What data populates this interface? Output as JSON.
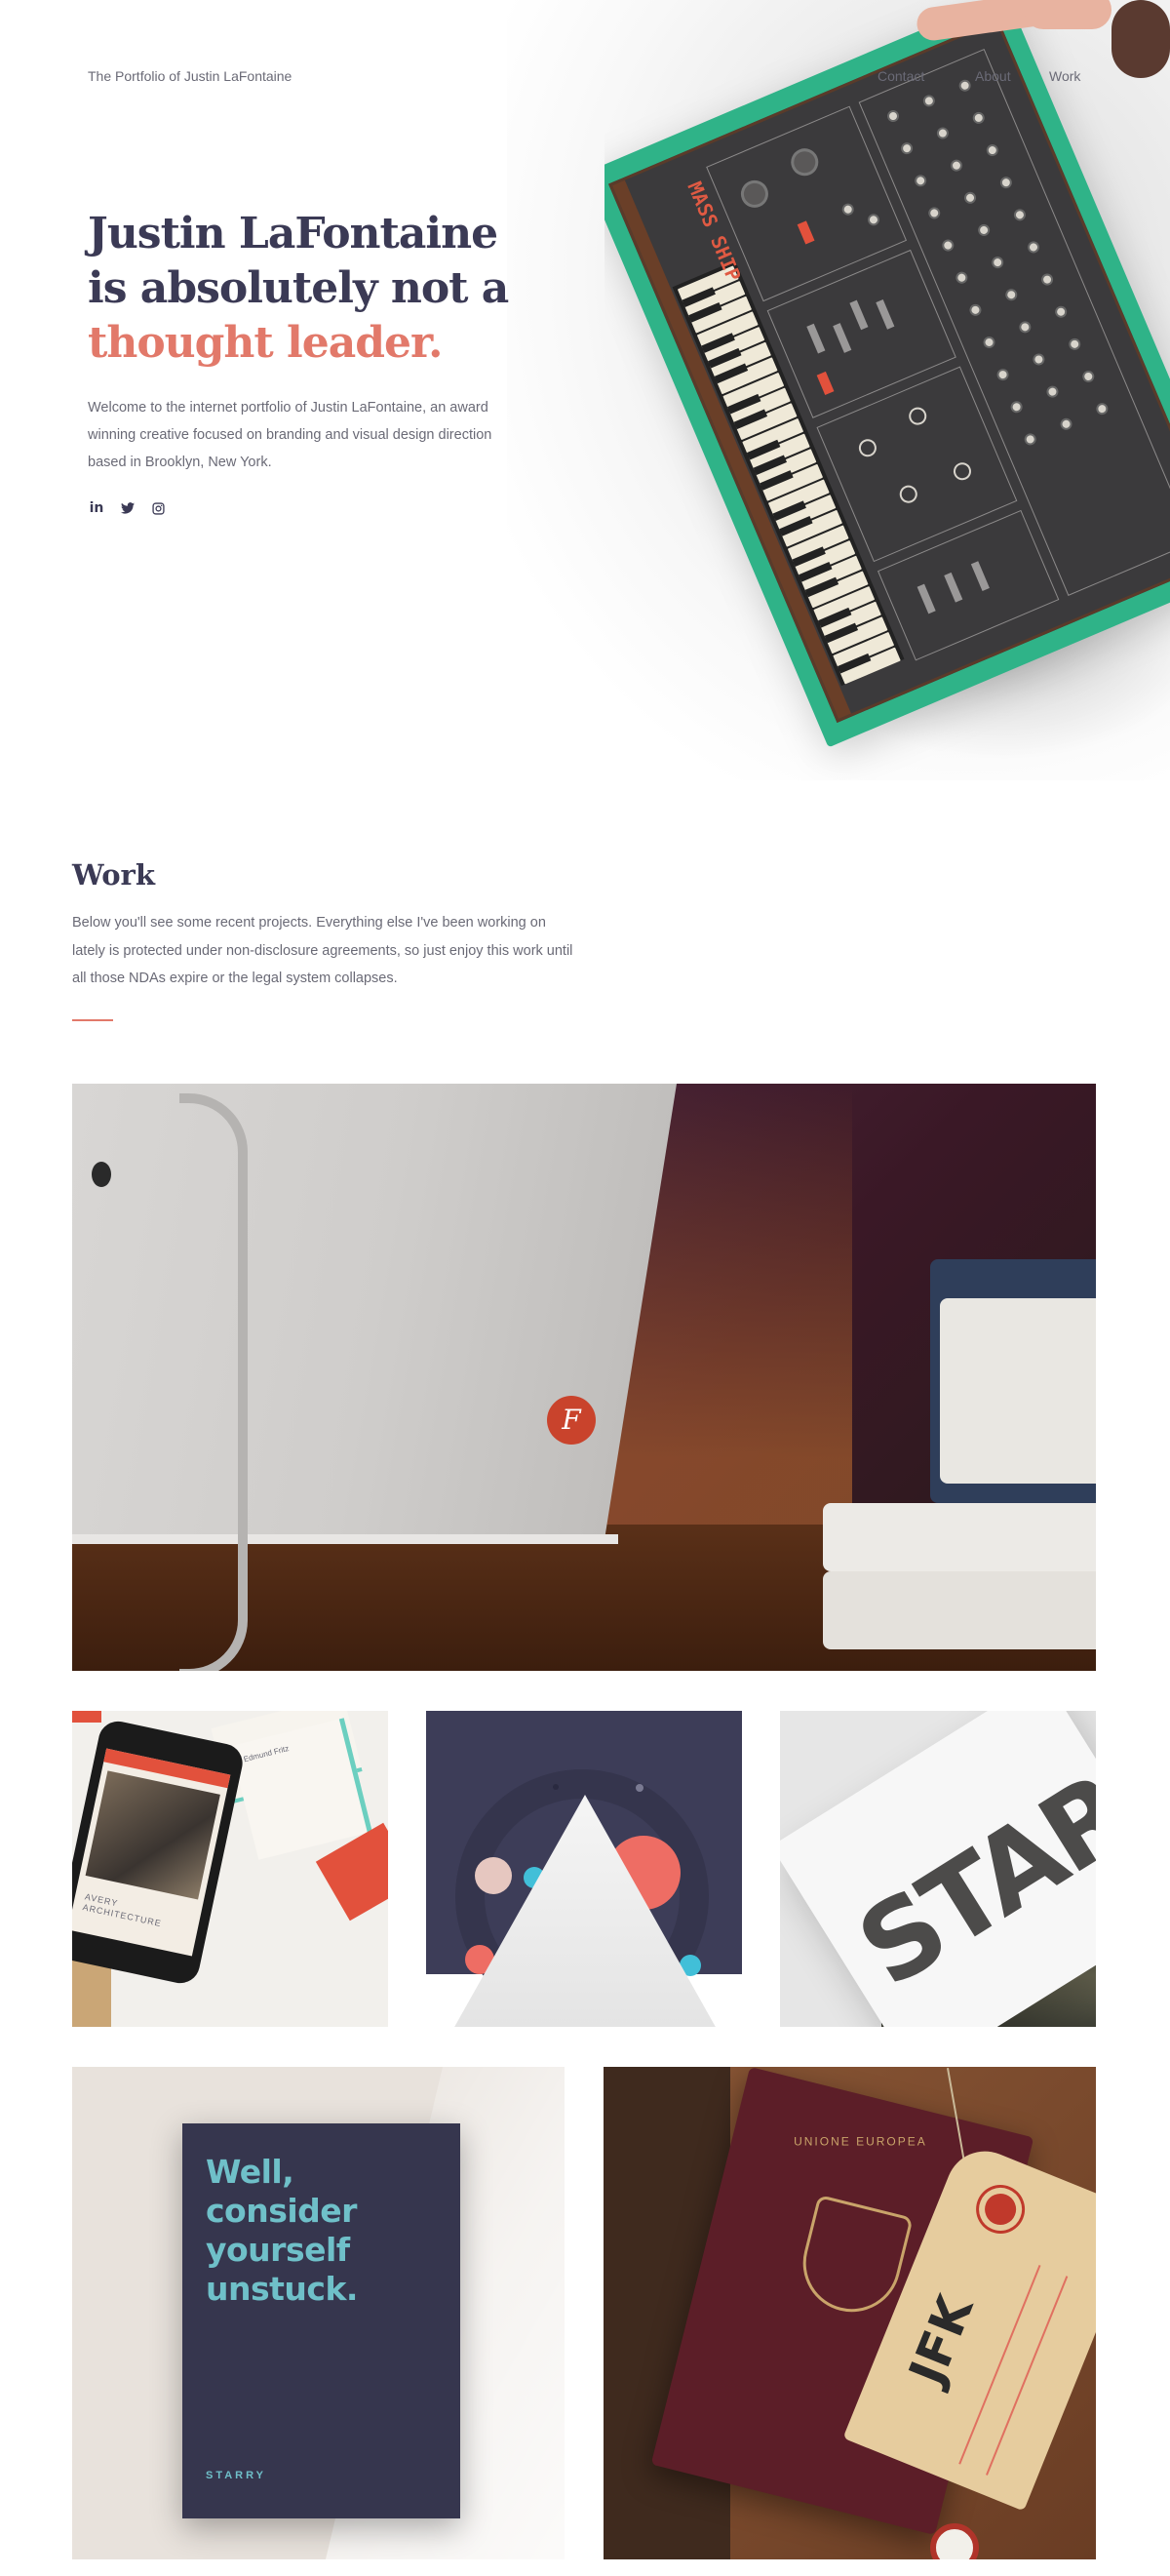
{
  "header": {
    "site_title": "The Portfolio of Justin LaFontaine",
    "nav": [
      "Contact",
      "About",
      "Work"
    ]
  },
  "hero": {
    "title_line1": "Justin LaFontaine",
    "title_line2": "is absolutely not a",
    "title_accent": "thought leader.",
    "description": "Welcome to the internet portfolio of Justin LaFontaine, an award winning creative focused on branding and visual design direction based in Brooklyn, New York.",
    "socials": [
      "linkedin-icon",
      "twitter-icon",
      "instagram-icon"
    ],
    "synth_brand": "MASS SHIP"
  },
  "work": {
    "title": "Work",
    "description": "Below you'll see some recent projects. Everything else I've been working on lately is protected under non-disclosure agreements, so just enjoy this work until all those NDAs expire or the legal system collapses."
  },
  "projects": {
    "phone_card_text": "AVERY ARCHITECTURE",
    "stationery_text": "Edmund Fritz",
    "starry_word": "STAR",
    "poster_title": "Well, consider yourself unstuck.",
    "poster_brand": "STARRY",
    "passport_text": "UNIONE EUROPEA",
    "tag_code": "JFK"
  },
  "colors": {
    "accent": "#e2796a",
    "heading": "#3b3a55",
    "body_text": "#6a6a76",
    "synth_green": "#2fb388"
  }
}
